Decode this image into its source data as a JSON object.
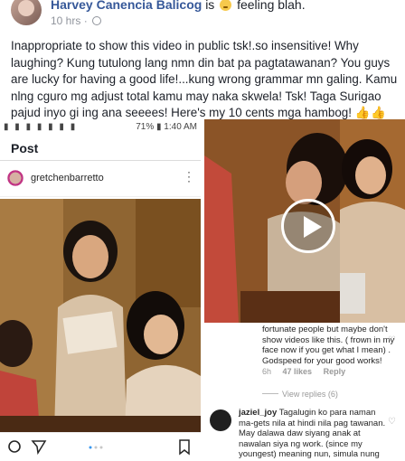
{
  "post": {
    "author": "Harvey Canencia Balicog",
    "feeling_prefix": "is",
    "feeling": "feeling blah.",
    "time": "10 hrs",
    "text": "Inappropriate to show this video in public tsk!.so insensitive! Why laughing? Kung tutulong lang nmn din bat pa pagtatawanan? You guys are lucky for having a good life!...kung wrong grammar mn galing. Kamu nlng cguro mg adjust total kamu may naka skwela! Tsk! Taga Surigao pajud inyo gi ing ana seeees! Here's my 10 cents mga hambog!",
    "thumbs": "👍👍👍"
  },
  "instagram": {
    "status_left": "▮ ▮ ▮ ▮ ▮ ▮ ▮",
    "status_right": "71% ▮ 1:40 AM",
    "title": "Post",
    "username": "gretchenbarretto"
  },
  "comments": {
    "c1_text": "fortunate people but maybe don't show videos like this. ( frown in my face now if you get what I mean) . Godspeed for your good works!",
    "c1_time": "6h",
    "c1_likes": "47 likes",
    "c1_reply": "Reply",
    "view_replies": "View replies (6)",
    "c2_user": "jaziel_joy",
    "c2_text": "Tagalugin ko para naman ma-gets nila at hindi nila pag tawanan. May dalawa daw siyang anak at nawalan siya ng work. (since my youngest) meaning nun, simula nung"
  }
}
